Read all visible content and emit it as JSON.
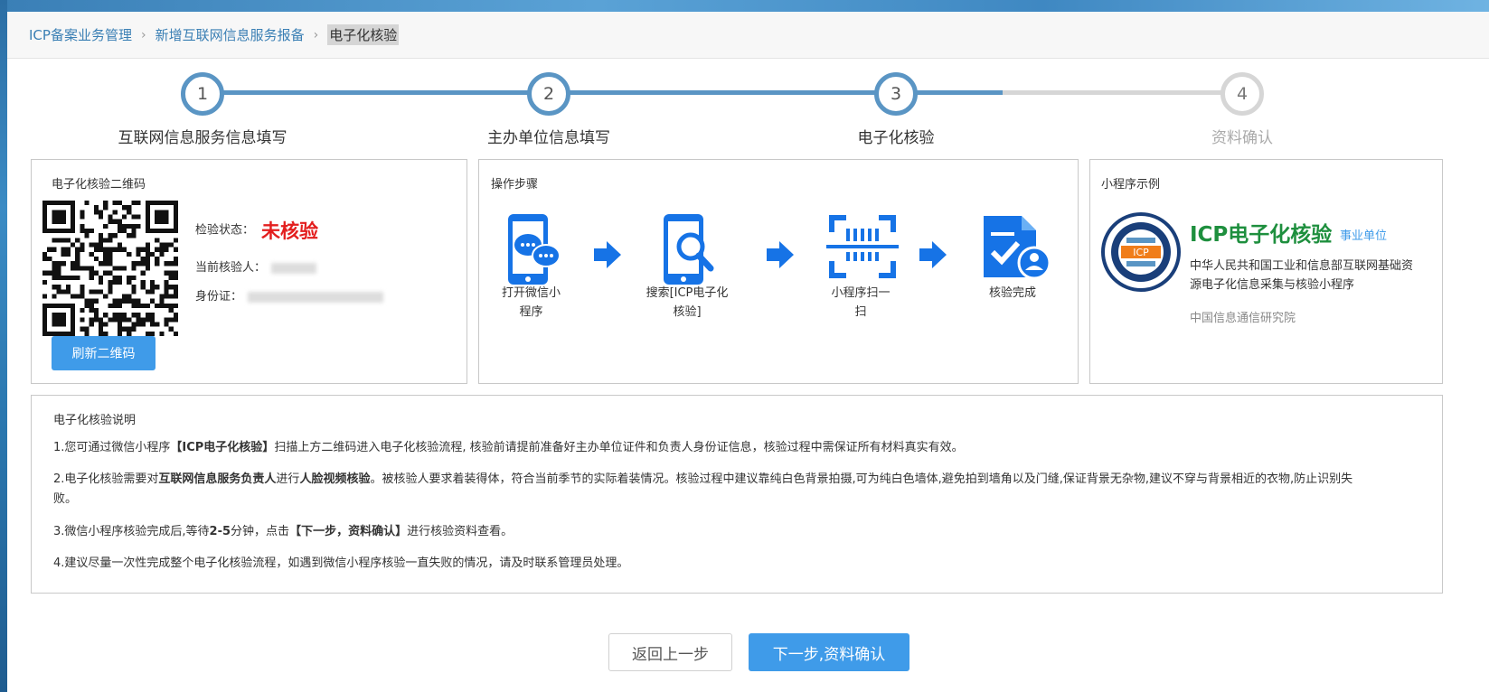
{
  "breadcrumb": {
    "items": [
      "ICP备案业务管理",
      "新增互联网信息服务报备"
    ],
    "current": "电子化核验",
    "separator": "›"
  },
  "stepper": {
    "steps": [
      {
        "num": "1",
        "label": "互联网信息服务信息填写",
        "active": true
      },
      {
        "num": "2",
        "label": "主办单位信息填写",
        "active": true
      },
      {
        "num": "3",
        "label": "电子化核验",
        "active": true
      },
      {
        "num": "4",
        "label": "资料确认",
        "active": false
      }
    ],
    "progress_fraction": 0.76
  },
  "qr_box": {
    "title": "电子化核验二维码",
    "status_label": "检验状态：",
    "status_value": "未核验",
    "verifier_label": "当前核验人：",
    "id_label": "身份证：",
    "refresh_button": "刷新二维码"
  },
  "steps_box": {
    "title": "操作步骤",
    "items": [
      {
        "line1": "打开微信小",
        "line2": "程序",
        "icon": "wechat-phone-icon"
      },
      {
        "line1": "搜索[ICP电子化",
        "line2": "核验]",
        "icon": "search-phone-icon"
      },
      {
        "line1": "小程序扫一",
        "line2": "扫",
        "icon": "scan-icon"
      },
      {
        "line1": "核验完成",
        "line2": "",
        "icon": "verified-document-icon"
      }
    ]
  },
  "miniprogram_box": {
    "title": "小程序示例",
    "app_title": "ICP电子化核验",
    "tag": "事业单位",
    "description": "中华人民共和国工业和信息部互联网基础资源电子化信息采集与核验小程序",
    "org": "中国信息通信研究院",
    "logo_text": "ICP"
  },
  "explanation": {
    "title": "电子化核验说明",
    "p1_a": "1.您可通过微信小程序",
    "p1_b": "【ICP电子化核验】",
    "p1_c": "扫描上方二维码进入电子化核验流程, 核验前请提前准备好主办单位证件和负责人身份证信息，核验过程中需保证所有材料真实有效。",
    "p2_a": "2.电子化核验需要对",
    "p2_b": "互联网信息服务负责人",
    "p2_c": "进行",
    "p2_d": "人脸视频核验",
    "p2_e": "。被核验人要求着装得体，符合当前季节的实际着装情况。核验过程中建议靠纯白色背景拍摄,可为纯白色墙体,避免拍到墙角以及门缝,保证背景无杂物,建议不穿与背景相近的衣物,防止识别失败。",
    "p3_a": "3.微信小程序核验完成后,等待",
    "p3_b": "2-5",
    "p3_c": "分钟，点击",
    "p3_d": "【下一步，资料确认】",
    "p3_e": "进行核验资料查看。",
    "p4": "4.建议尽量一次性完成整个电子化核验流程，如遇到微信小程序核验一直失败的情况，请及时联系管理员处理。"
  },
  "footer": {
    "back_button": "返回上一步",
    "next_button": "下一步,资料确认"
  },
  "colors": {
    "accent": "#3f9be9",
    "step_active": "#5a95c4",
    "status_red": "#e31e1e",
    "mini_green": "#1e8f3e"
  }
}
